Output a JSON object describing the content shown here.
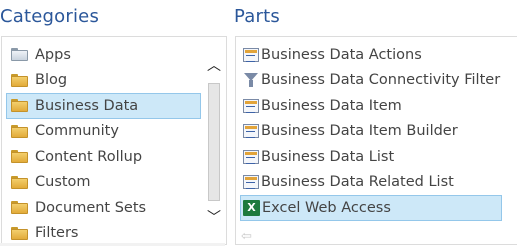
{
  "categories": {
    "title": "Categories",
    "items": [
      {
        "label": "Apps",
        "icon": "apps-icon"
      },
      {
        "label": "Blog",
        "icon": "folder-icon"
      },
      {
        "label": "Business Data",
        "icon": "folder-icon",
        "selected": true
      },
      {
        "label": "Community",
        "icon": "folder-icon"
      },
      {
        "label": "Content Rollup",
        "icon": "folder-icon"
      },
      {
        "label": "Custom",
        "icon": "folder-icon"
      },
      {
        "label": "Document Sets",
        "icon": "folder-icon"
      },
      {
        "label": "Filters",
        "icon": "folder-icon"
      }
    ]
  },
  "parts": {
    "title": "Parts",
    "items": [
      {
        "label": "Business Data Actions",
        "icon": "web-part-icon"
      },
      {
        "label": "Business Data Connectivity Filter",
        "icon": "filter-icon"
      },
      {
        "label": "Business Data Item",
        "icon": "web-part-icon"
      },
      {
        "label": "Business Data Item Builder",
        "icon": "web-part-icon"
      },
      {
        "label": "Business Data List",
        "icon": "web-part-icon"
      },
      {
        "label": "Business Data Related List",
        "icon": "web-part-icon"
      },
      {
        "label": "Excel Web Access",
        "icon": "excel-icon",
        "selected": true
      }
    ]
  },
  "colors": {
    "heading": "#2b579a",
    "selection_bg": "#cde8f8",
    "selection_border": "#94c7ea"
  }
}
